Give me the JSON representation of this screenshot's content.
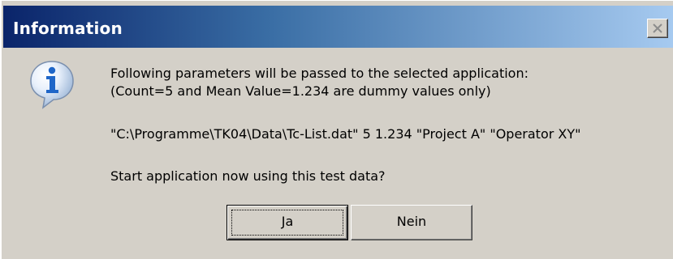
{
  "window": {
    "title": "Information",
    "close_icon": "close-icon"
  },
  "message": {
    "icon": "info-icon",
    "line1": "Following parameters will be passed to the selected application:",
    "line2": "(Count=5 and Mean Value=1.234 are dummy values only)",
    "command": "\"C:\\Programme\\TK04\\Data\\Tc-List.dat\" 5 1.234 \"Project A\" \"Operator XY\"",
    "question": "Start application now using this test data?"
  },
  "buttons": {
    "yes_label": "Ja",
    "no_label": "Nein"
  },
  "colors": {
    "title_gradient_start": "#0a246a",
    "title_gradient_end": "#a6caf0",
    "dialog_face": "#d4d0c8",
    "icon_blue": "#1f66c8"
  }
}
